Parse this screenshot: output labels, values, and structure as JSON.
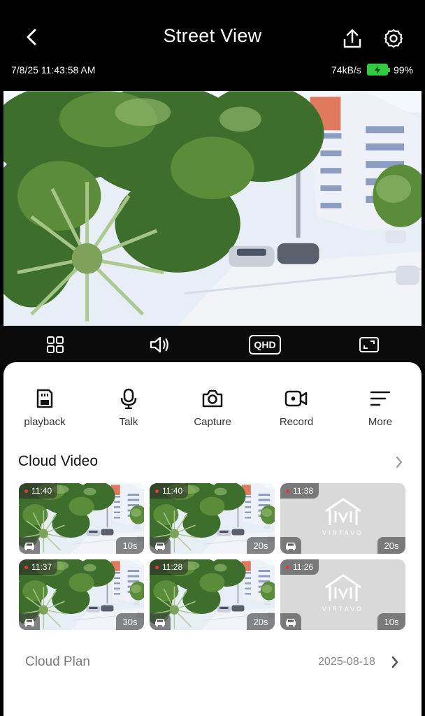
{
  "header": {
    "title": "Street View",
    "back_icon": "chevron-left-icon",
    "share_icon": "share-upload-icon",
    "settings_icon": "gear-icon"
  },
  "status": {
    "timestamp": "7/8/25 11:43:58 AM",
    "bitrate": "74kB/s",
    "battery_percent": "99%",
    "battery_color": "#2ecc40"
  },
  "controls": {
    "quality": "QHD",
    "icons": [
      "multi-view-grid-icon",
      "speaker-icon",
      "quality-badge",
      "fullscreen-icon"
    ]
  },
  "actions": [
    {
      "label": "playback",
      "icon": "sd-card-icon"
    },
    {
      "label": "Talk",
      "icon": "microphone-icon"
    },
    {
      "label": "Capture",
      "icon": "camera-icon"
    },
    {
      "label": "Record",
      "icon": "video-camera-icon"
    },
    {
      "label": "More",
      "icon": "menu-lines-icon"
    }
  ],
  "cloud_video": {
    "title": "Cloud Video",
    "clips": [
      {
        "time": "11:40",
        "duration": "10s",
        "thumbnail": "street-snapshot"
      },
      {
        "time": "11:40",
        "duration": "20s",
        "thumbnail": "street-snapshot"
      },
      {
        "time": "11:38",
        "duration": "20s",
        "thumbnail": "virtavo-placeholder"
      },
      {
        "time": "11:37",
        "duration": "30s",
        "thumbnail": "street-snapshot"
      },
      {
        "time": "11:28",
        "duration": "20s",
        "thumbnail": "street-snapshot"
      },
      {
        "time": "11:26",
        "duration": "10s",
        "thumbnail": "virtavo-placeholder"
      }
    ],
    "placeholder_brand": "VIRTAVO"
  },
  "cloud_plan": {
    "label": "Cloud Plan",
    "date": "2025-08-18"
  }
}
